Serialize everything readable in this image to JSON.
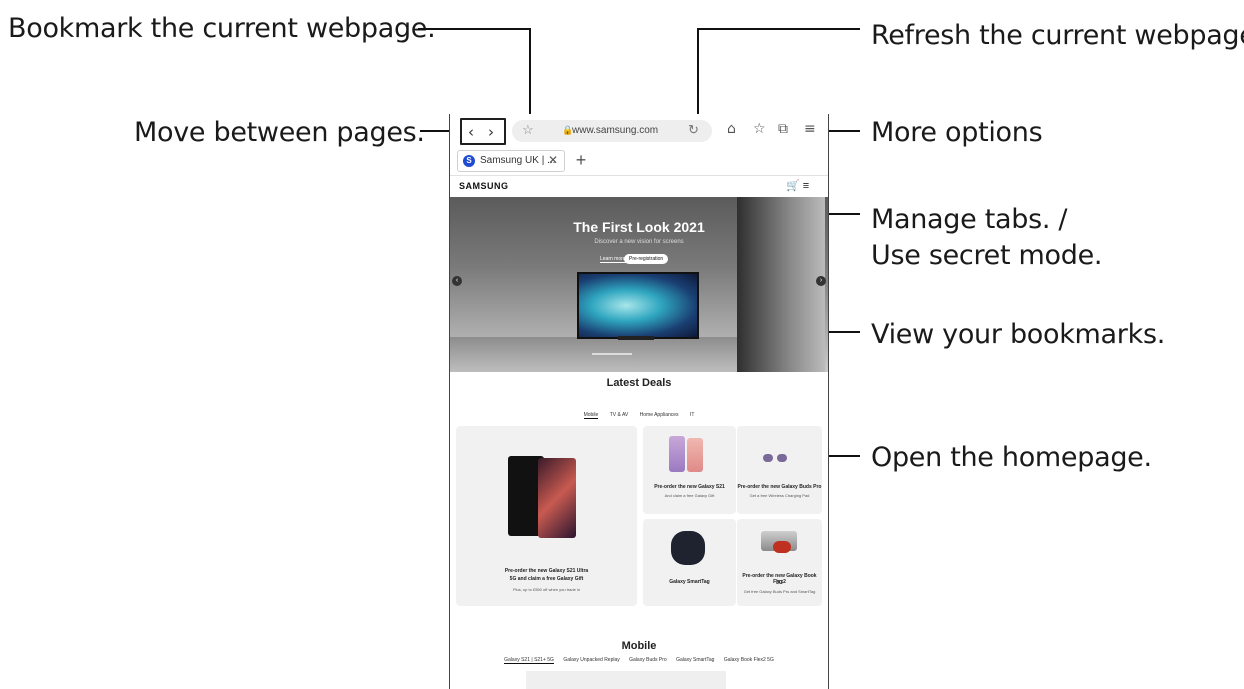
{
  "callouts": {
    "bookmark": "Bookmark the current webpage.",
    "refresh": "Refresh the current webpage.",
    "move": "Move between pages.",
    "more": "More options",
    "manage_tabs_1": "Manage tabs. /",
    "manage_tabs_2": "Use secret mode.",
    "bookmarks": "View your bookmarks.",
    "homepage": "Open the homepage."
  },
  "browser": {
    "back_icon": "‹",
    "forward_icon": "›",
    "bookmark_icon": "☆",
    "lock_icon": "🔒",
    "url": "www.samsung.com",
    "refresh_icon": "↻",
    "home_icon": "⌂",
    "bookmarks_icon": "☆",
    "tabs_icon": "⧉",
    "menu_icon": "≡",
    "tab_favicon": "S",
    "tab_title": "Samsung UK | ...",
    "tab_close": "✕",
    "new_tab": "+"
  },
  "site": {
    "logo": "SAMSUNG",
    "header_icons": "🛒 ≡",
    "hero": {
      "title": "The First Look 2021",
      "subtitle": "Discover a new vision for screens",
      "learn_more": "Learn more",
      "pre_register": "Pre-registration"
    },
    "latest_deals": "Latest Deals",
    "categories": [
      "Mobile",
      "TV & AV",
      "Home Appliances",
      "IT"
    ],
    "cards": {
      "s21_ultra_title_1": "Pre-order the new Galaxy S21 Ultra",
      "s21_ultra_title_2": "5G and claim a free Galaxy Gift",
      "s21_ultra_sub": "Plus, up to £550 off when you trade in",
      "s21_title": "Pre-order the new Galaxy S21",
      "s21_sub": "And claim a free Galaxy Gift",
      "buds_title": "Pre-order the new Galaxy Buds Pro",
      "buds_sub": "Get a free Wireless Charging Pad",
      "smarttag_title": "Galaxy SmartTag",
      "bookflex_title_1": "Pre-order the new Galaxy Book Flex2",
      "bookflex_title_2": "5G",
      "bookflex_sub": "Get free Galaxy Buds Pro and SmartTag"
    },
    "mobile_title": "Mobile",
    "mobile_tabs": [
      "Galaxy S21 | S21+ 5G",
      "Galaxy Unpacked Replay",
      "Galaxy Buds Pro",
      "Galaxy SmartTag",
      "Galaxy Book Flex2 5G"
    ]
  }
}
